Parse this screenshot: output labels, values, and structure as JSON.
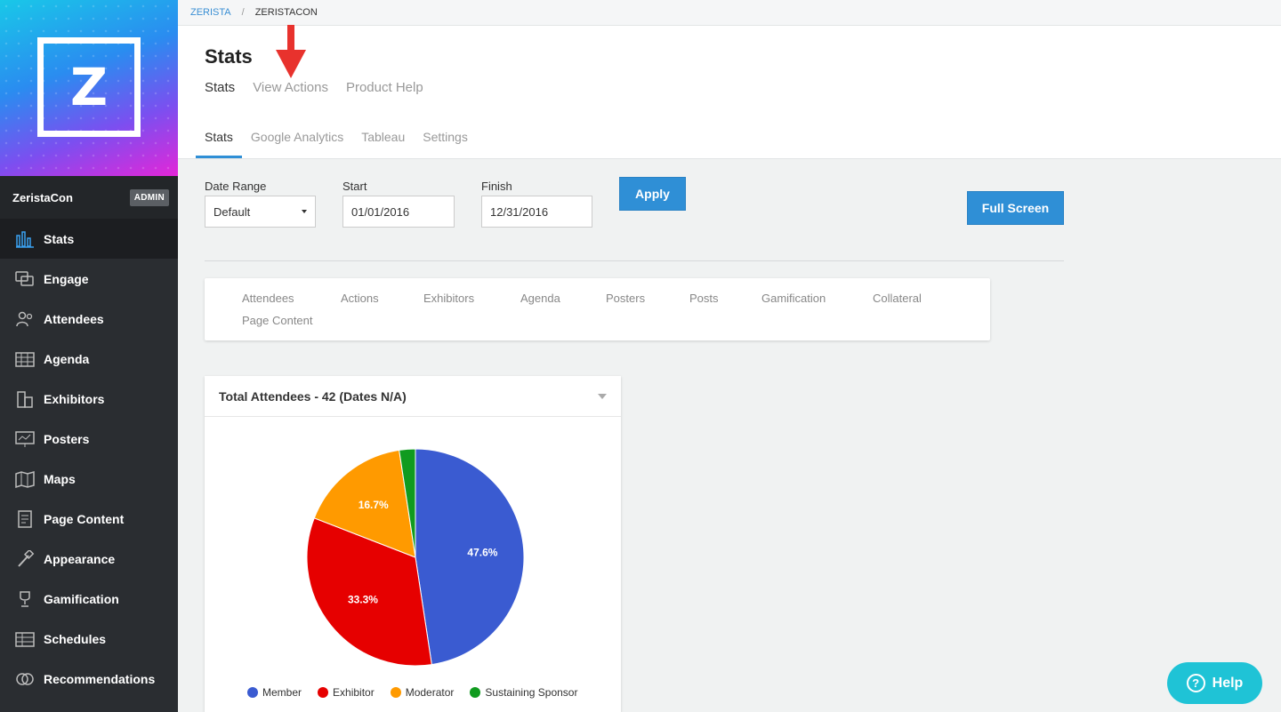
{
  "breadcrumb": {
    "root": "ZERISTA",
    "separator": "/",
    "current": "ZERISTACON"
  },
  "sidebar": {
    "org_name": "ZeristaCon",
    "badge": "ADMIN",
    "items": [
      {
        "label": "Stats",
        "icon": "bar-chart-icon"
      },
      {
        "label": "Engage",
        "icon": "chat-bubbles-icon"
      },
      {
        "label": "Attendees",
        "icon": "people-icon"
      },
      {
        "label": "Agenda",
        "icon": "grid-icon"
      },
      {
        "label": "Exhibitors",
        "icon": "building-icon"
      },
      {
        "label": "Posters",
        "icon": "presentation-icon"
      },
      {
        "label": "Maps",
        "icon": "map-icon"
      },
      {
        "label": "Page Content",
        "icon": "document-icon"
      },
      {
        "label": "Appearance",
        "icon": "brush-icon"
      },
      {
        "label": "Gamification",
        "icon": "trophy-icon"
      },
      {
        "label": "Schedules",
        "icon": "table-icon"
      },
      {
        "label": "Recommendations",
        "icon": "rings-icon"
      }
    ]
  },
  "header": {
    "title": "Stats",
    "subnav": [
      "Stats",
      "View Actions",
      "Product Help"
    ],
    "tabs": [
      "Stats",
      "Google Analytics",
      "Tableau",
      "Settings"
    ]
  },
  "filters": {
    "date_range_label": "Date Range",
    "date_range_value": "Default",
    "start_label": "Start",
    "start_value": "01/01/2016",
    "finish_label": "Finish",
    "finish_value": "12/31/2016",
    "apply_label": "Apply",
    "fullscreen_label": "Full Screen"
  },
  "categories": [
    "Attendees",
    "Actions",
    "Exhibitors",
    "Agenda",
    "Posters",
    "Posts",
    "Gamification",
    "Collateral",
    "Page Content"
  ],
  "chart_card": {
    "title": "Total Attendees - 42 (Dates N/A)"
  },
  "chart_data": {
    "type": "pie",
    "title": "Total Attendees - 42 (Dates N/A)",
    "categories": [
      "Member",
      "Exhibitor",
      "Moderator",
      "Sustaining Sponsor"
    ],
    "values": [
      47.6,
      33.3,
      16.7,
      2.4
    ],
    "labels": [
      "47.6%",
      "33.3%",
      "16.7%",
      ""
    ],
    "colors": [
      "#3a5bd1",
      "#e60000",
      "#ff9a00",
      "#109b1f"
    ],
    "legend_position": "bottom"
  },
  "help_label": "Help",
  "colors": {
    "accent": "#2f8fd6",
    "sidebar": "#2a2d31",
    "help": "#1fc3d6",
    "arrow": "#e8322d"
  }
}
